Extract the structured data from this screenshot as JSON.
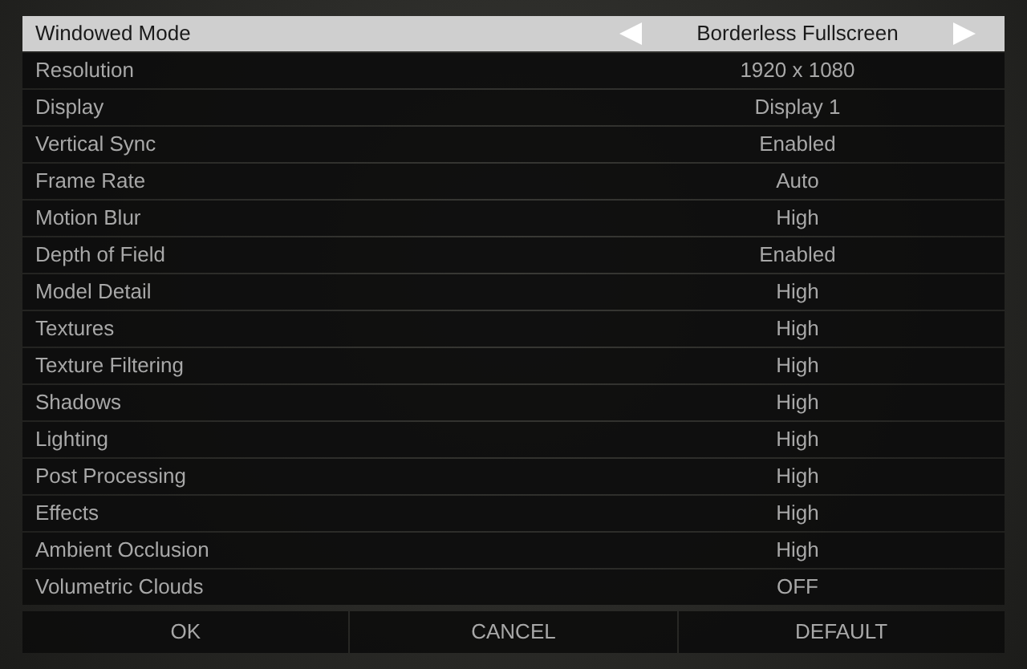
{
  "settings": [
    {
      "label": "Windowed Mode",
      "value": "Borderless Fullscreen",
      "selected": true
    },
    {
      "label": "Resolution",
      "value": "1920 x 1080",
      "selected": false
    },
    {
      "label": "Display",
      "value": "Display 1",
      "selected": false
    },
    {
      "label": "Vertical Sync",
      "value": "Enabled",
      "selected": false
    },
    {
      "label": "Frame Rate",
      "value": "Auto",
      "selected": false
    },
    {
      "label": "Motion Blur",
      "value": "High",
      "selected": false
    },
    {
      "label": "Depth of Field",
      "value": "Enabled",
      "selected": false
    },
    {
      "label": "Model Detail",
      "value": "High",
      "selected": false
    },
    {
      "label": "Textures",
      "value": "High",
      "selected": false
    },
    {
      "label": "Texture Filtering",
      "value": "High",
      "selected": false
    },
    {
      "label": "Shadows",
      "value": "High",
      "selected": false
    },
    {
      "label": "Lighting",
      "value": "High",
      "selected": false
    },
    {
      "label": "Post Processing",
      "value": "High",
      "selected": false
    },
    {
      "label": "Effects",
      "value": "High",
      "selected": false
    },
    {
      "label": "Ambient Occlusion",
      "value": "High",
      "selected": false
    },
    {
      "label": "Volumetric Clouds",
      "value": "OFF",
      "selected": false
    }
  ],
  "buttons": [
    "OK",
    "CANCEL",
    "DEFAULT"
  ]
}
